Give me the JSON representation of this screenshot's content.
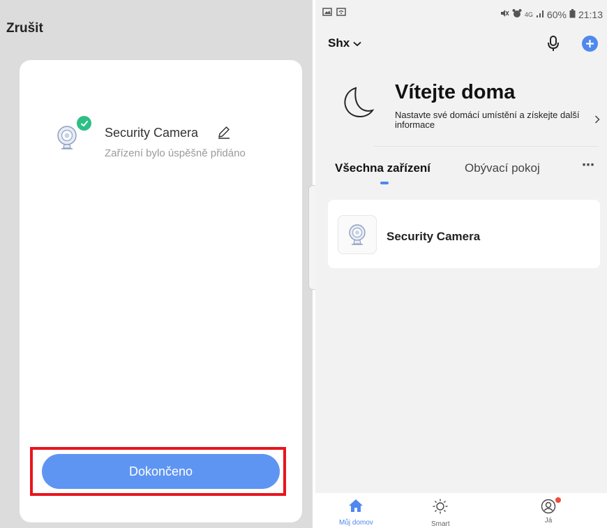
{
  "left_screen": {
    "cancel_label": "Zrušit",
    "device": {
      "name": "Security Camera",
      "status": "Zařízení bylo úspěšně přidáno",
      "icon": "camera-icon",
      "badge_icon": "check-icon"
    },
    "done_label": "Dokončeno",
    "colors": {
      "primary": "#5f95f2",
      "success": "#2dbf86",
      "highlight": "#e8151d"
    }
  },
  "right_screen": {
    "status_bar": {
      "icons_left": [
        "image-icon",
        "wifi-icon"
      ],
      "icons_right": [
        "mute-icon",
        "alarm-icon",
        "network-icon",
        "signal-icon"
      ],
      "network": "4G",
      "battery": "60%",
      "time": "21:13"
    },
    "header": {
      "home_name": "Shx",
      "mic_icon": "mic-icon",
      "add_icon": "plus-icon"
    },
    "welcome": {
      "title": "Vítejte doma",
      "subtitle": "Nastavte své domácí umístění a získejte další informace"
    },
    "tabs": [
      {
        "label": "Všechna zařízení",
        "active": true
      },
      {
        "label": "Obývací pokoj",
        "active": false
      }
    ],
    "devices": [
      {
        "name": "Security Camera"
      }
    ],
    "bottom_nav": [
      {
        "label": "Můj domov",
        "icon": "home-icon",
        "active": true
      },
      {
        "label": "Smart",
        "icon": "sun-icon",
        "active": false
      },
      {
        "label": "Já",
        "icon": "profile-icon",
        "active": false
      }
    ],
    "colors": {
      "accent": "#4f88ef",
      "notification": "#f04a3c"
    }
  }
}
